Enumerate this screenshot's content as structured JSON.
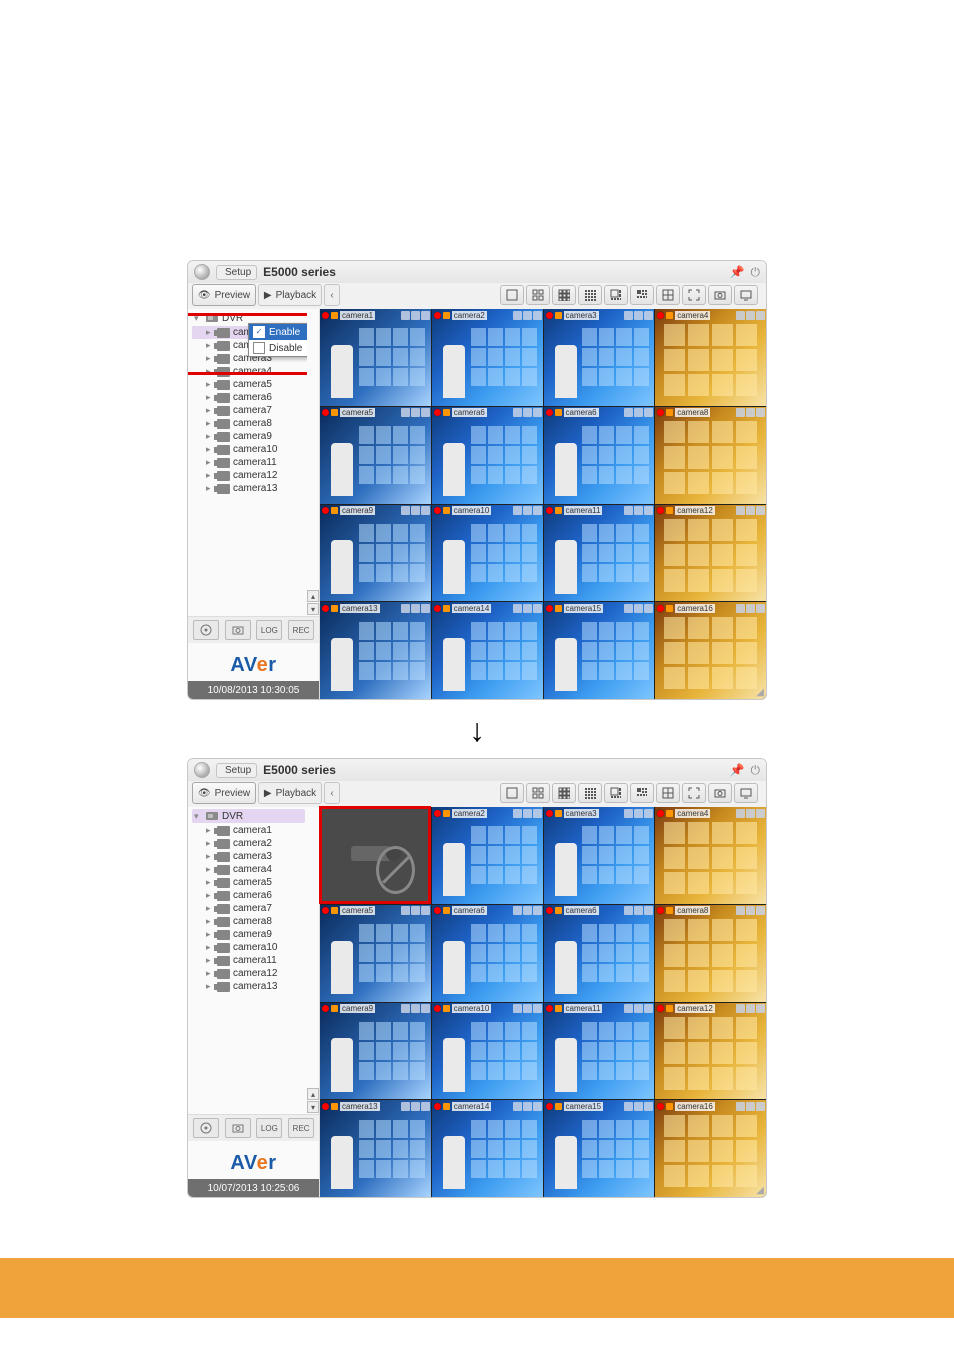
{
  "header": {
    "setup_label": "Setup",
    "title": "E5000 series",
    "pin_icon": "pin-icon",
    "power_icon": "power-icon"
  },
  "tabs": {
    "preview": "Preview",
    "playback": "Playback"
  },
  "toolbar": {
    "buttons": [
      "single-view-icon",
      "grid-2x2-icon",
      "grid-3x3-icon",
      "grid-4x4-icon",
      "layout-a-icon",
      "layout-b-icon",
      "layout-c-icon",
      "fullscreen-icon",
      "snapshot-icon",
      "monitor-icon"
    ]
  },
  "tree": {
    "root_label": "DVR",
    "cameras": [
      "camera1",
      "camera2",
      "camera3",
      "camera4",
      "camera5",
      "camera6",
      "camera7",
      "camera8",
      "camera9",
      "camera10",
      "camera11",
      "camera12",
      "camera13"
    ]
  },
  "context_menu": {
    "enable": "Enable",
    "disable": "Disable"
  },
  "sidebar_buttons": [
    "ptz-icon",
    "snapshot-panel-icon",
    "log-button",
    "rec-button"
  ],
  "brand": {
    "a": "A",
    "v": "V",
    "e": "e",
    "r": "r"
  },
  "timestamps": {
    "top": "10/08/2013 10:30:05",
    "bottom": "10/07/2013 10:25:06"
  },
  "cells": [
    [
      {
        "label": "camera1",
        "style": "room"
      },
      {
        "label": "camera2",
        "style": "blue"
      },
      {
        "label": "camera3",
        "style": "blue"
      },
      {
        "label": "camera4",
        "style": "store"
      }
    ],
    [
      {
        "label": "camera5",
        "style": "room"
      },
      {
        "label": "camera6",
        "style": "blue"
      },
      {
        "label": "camera6",
        "style": "blue"
      },
      {
        "label": "camera8",
        "style": "store"
      }
    ],
    [
      {
        "label": "camera9",
        "style": "room"
      },
      {
        "label": "camera10",
        "style": "blue"
      },
      {
        "label": "camera11",
        "style": "blue"
      },
      {
        "label": "camera12",
        "style": "store"
      }
    ],
    [
      {
        "label": "camera13",
        "style": "room"
      },
      {
        "label": "camera14",
        "style": "blue"
      },
      {
        "label": "camera15",
        "style": "blue"
      },
      {
        "label": "camera16",
        "style": "store"
      }
    ]
  ],
  "cells_bottom": [
    [
      {
        "label": "",
        "style": "off"
      },
      {
        "label": "camera2",
        "style": "blue"
      },
      {
        "label": "camera3",
        "style": "blue"
      },
      {
        "label": "camera4",
        "style": "store"
      }
    ],
    [
      {
        "label": "camera5",
        "style": "room"
      },
      {
        "label": "camera6",
        "style": "blue"
      },
      {
        "label": "camera6",
        "style": "blue"
      },
      {
        "label": "camera8",
        "style": "store"
      }
    ],
    [
      {
        "label": "camera9",
        "style": "room"
      },
      {
        "label": "camera10",
        "style": "blue"
      },
      {
        "label": "camera11",
        "style": "blue"
      },
      {
        "label": "camera12",
        "style": "store"
      }
    ],
    [
      {
        "label": "camera13",
        "style": "room"
      },
      {
        "label": "camera14",
        "style": "blue"
      },
      {
        "label": "camera15",
        "style": "blue"
      },
      {
        "label": "camera16",
        "style": "store"
      }
    ]
  ]
}
